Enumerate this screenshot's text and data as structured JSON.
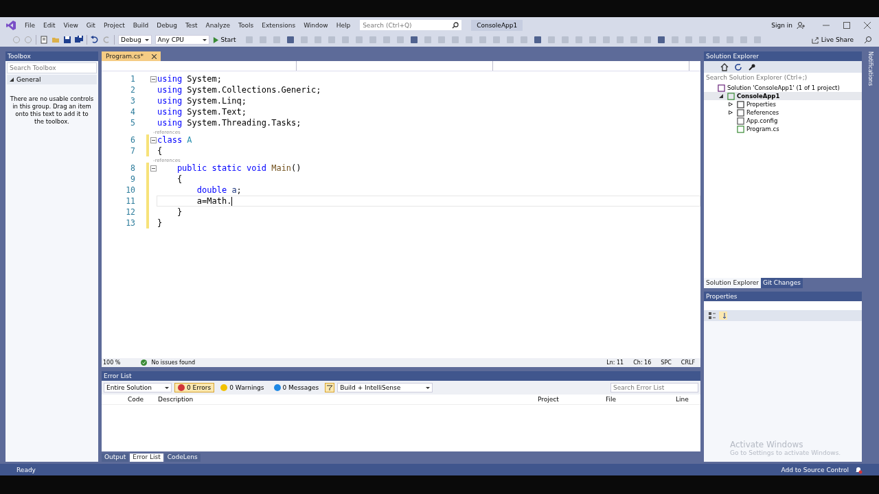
{
  "menu": [
    "File",
    "Edit",
    "View",
    "Git",
    "Project",
    "Build",
    "Debug",
    "Test",
    "Analyze",
    "Tools",
    "Extensions",
    "Window",
    "Help"
  ],
  "search": {
    "placeholder": "Search (Ctrl+Q)"
  },
  "solution_name": "ConsoleApp1",
  "account": {
    "label": "Sign in"
  },
  "toolbar": {
    "configuration": "Debug",
    "platform": "Any CPU",
    "start": "Start",
    "live_share": "Live Share"
  },
  "toolbox": {
    "title": "Toolbox",
    "search_placeholder": "Search Toolbox",
    "group": {
      "label": "General",
      "expanded": true
    },
    "empty_message": "There are no usable controls in this group. Drag an item onto this text to add it to the toolbox."
  },
  "editor": {
    "tab": {
      "label": "Program.cs*",
      "selected": true
    },
    "lines": [
      {
        "number": "1",
        "fold": true,
        "changed": false,
        "current": false,
        "tokens": [
          {
            "kind": "keyword",
            "text": "using"
          },
          {
            "kind": "plain",
            "text": " System;"
          }
        ]
      },
      {
        "number": "2",
        "fold": false,
        "changed": false,
        "current": false,
        "tokens": [
          {
            "kind": "keyword",
            "text": "using"
          },
          {
            "kind": "plain",
            "text": " System.Collections.Generic;"
          }
        ]
      },
      {
        "number": "3",
        "fold": false,
        "changed": false,
        "current": false,
        "tokens": [
          {
            "kind": "keyword",
            "text": "using"
          },
          {
            "kind": "plain",
            "text": " System.Linq;"
          }
        ]
      },
      {
        "number": "4",
        "fold": false,
        "changed": false,
        "current": false,
        "tokens": [
          {
            "kind": "keyword",
            "text": "using"
          },
          {
            "kind": "plain",
            "text": " System.Text;"
          }
        ]
      },
      {
        "number": "5",
        "fold": false,
        "changed": false,
        "current": false,
        "tokens": [
          {
            "kind": "keyword",
            "text": "using"
          },
          {
            "kind": "plain",
            "text": " System.Threading.Tasks;"
          }
        ]
      },
      {
        "number": "6",
        "fold": true,
        "changed": true,
        "current": false,
        "lens": "-references",
        "tokens": [
          {
            "kind": "keyword",
            "text": "class"
          },
          {
            "kind": "type",
            "text": " A"
          }
        ]
      },
      {
        "number": "7",
        "fold": false,
        "changed": true,
        "current": false,
        "tokens": [
          {
            "kind": "plain",
            "text": "{"
          }
        ]
      },
      {
        "number": "8",
        "fold": true,
        "changed": true,
        "current": false,
        "lens": "-references",
        "tokens": [
          {
            "kind": "keyword",
            "text": "    public static void"
          },
          {
            "kind": "method",
            "text": " Main"
          },
          {
            "kind": "plain",
            "text": "()"
          }
        ]
      },
      {
        "number": "9",
        "fold": false,
        "changed": true,
        "current": false,
        "tokens": [
          {
            "kind": "plain",
            "text": "    {"
          }
        ]
      },
      {
        "number": "10",
        "fold": false,
        "changed": true,
        "current": false,
        "tokens": [
          {
            "kind": "keyword",
            "text": "        double"
          },
          {
            "kind": "variable",
            "text": " a"
          },
          {
            "kind": "plain",
            "text": ";"
          }
        ]
      },
      {
        "number": "11",
        "fold": false,
        "changed": true,
        "current": true,
        "tokens": [
          {
            "kind": "plain",
            "text": "        a=Math."
          }
        ]
      },
      {
        "number": "12",
        "fold": false,
        "changed": true,
        "current": false,
        "tokens": [
          {
            "kind": "plain",
            "text": "    }"
          }
        ]
      },
      {
        "number": "13",
        "fold": false,
        "changed": true,
        "current": false,
        "tokens": [
          {
            "kind": "plain",
            "text": "}"
          }
        ]
      }
    ],
    "zoom": "100 %",
    "issues": "No issues found",
    "line": "Ln: 11",
    "column": "Ch: 16",
    "whitespace": "SPC",
    "line_ending": "CRLF"
  },
  "solution_explorer": {
    "title": "Solution Explorer",
    "search_placeholder": "Search Solution Explorer (Ctrl+;)",
    "tree": [
      {
        "label": "Solution 'ConsoleApp1' (1 of 1 project)",
        "kind": "solution",
        "selected": false,
        "children": [
          {
            "label": "ConsoleApp1",
            "kind": "project",
            "selected": true,
            "expanded": true,
            "children": [
              {
                "label": "Properties",
                "kind": "properties",
                "selected": false,
                "expanded": false
              },
              {
                "label": "References",
                "kind": "references",
                "selected": false,
                "expanded": false
              },
              {
                "label": "App.config",
                "kind": "config",
                "selected": false
              },
              {
                "label": "Program.cs",
                "kind": "csharp",
                "selected": false
              }
            ]
          }
        ]
      }
    ],
    "tabs": [
      {
        "label": "Solution Explorer",
        "selected": true
      },
      {
        "label": "Git Changes",
        "selected": false
      }
    ]
  },
  "properties": {
    "title": "Properties"
  },
  "error_list": {
    "title": "Error List",
    "scope": "Entire Solution",
    "filters": [
      {
        "kind": "errors",
        "label": "0 Errors",
        "selected": true
      },
      {
        "kind": "warnings",
        "label": "0 Warnings",
        "selected": false
      },
      {
        "kind": "messages",
        "label": "0 Messages",
        "selected": false
      }
    ],
    "source": "Build + IntelliSense",
    "search_placeholder": "Search Error List",
    "columns": [
      "Code",
      "Description",
      "Project",
      "File",
      "Line"
    ]
  },
  "bottom_tabs": [
    {
      "label": "Output",
      "selected": false
    },
    {
      "label": "Error List",
      "selected": true
    },
    {
      "label": "CodeLens",
      "selected": false
    }
  ],
  "activation": {
    "title": "Activate Windows",
    "message": "Go to Settings to activate Windows."
  },
  "notifications_label": "Notifications",
  "status": {
    "text": "Ready",
    "source_control": "Add to Source Control"
  }
}
